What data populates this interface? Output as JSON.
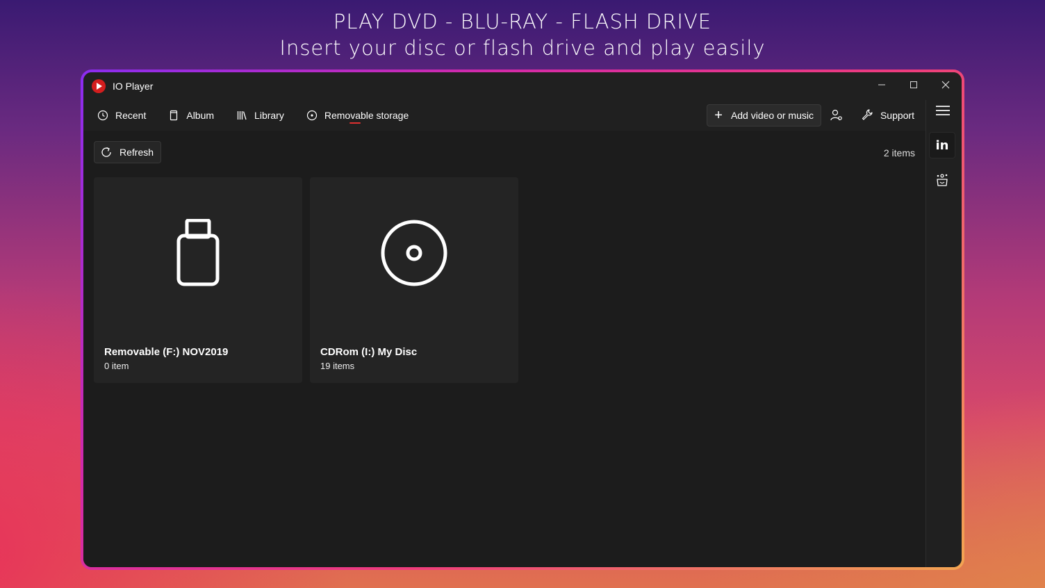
{
  "headline": {
    "line1": "PLAY DVD - BLU-RAY - FLASH DRIVE",
    "line2": "Insert your disc or flash drive and play easily"
  },
  "window": {
    "title": "IO Player",
    "controls": [
      "minimize-icon",
      "maximize-icon",
      "close-icon"
    ]
  },
  "nav": {
    "items": [
      {
        "label": "Recent",
        "icon": "clock-icon"
      },
      {
        "label": "Album",
        "icon": "album-icon"
      },
      {
        "label": "Library",
        "icon": "library-icon"
      },
      {
        "label": "Removable storage",
        "icon": "disc-icon",
        "active": true
      }
    ],
    "add_label": "Add video or music",
    "support_label": "Support"
  },
  "toolbar": {
    "refresh_label": "Refresh",
    "item_count": "2 items"
  },
  "drives": [
    {
      "name": "Removable (F:) NOV2019",
      "count": "0 item",
      "icon": "usb-drive-icon"
    },
    {
      "name": "CDRom (I:) My Disc",
      "count": "19 items",
      "icon": "cd-disc-icon"
    }
  ],
  "sidebar": {
    "linkedin_label": "in",
    "icons": [
      "menu-icon",
      "linkedin-icon",
      "share-icon"
    ]
  },
  "colors": {
    "accent": "#e03030",
    "window_bg": "#1c1c1c",
    "card_bg": "#242424"
  }
}
